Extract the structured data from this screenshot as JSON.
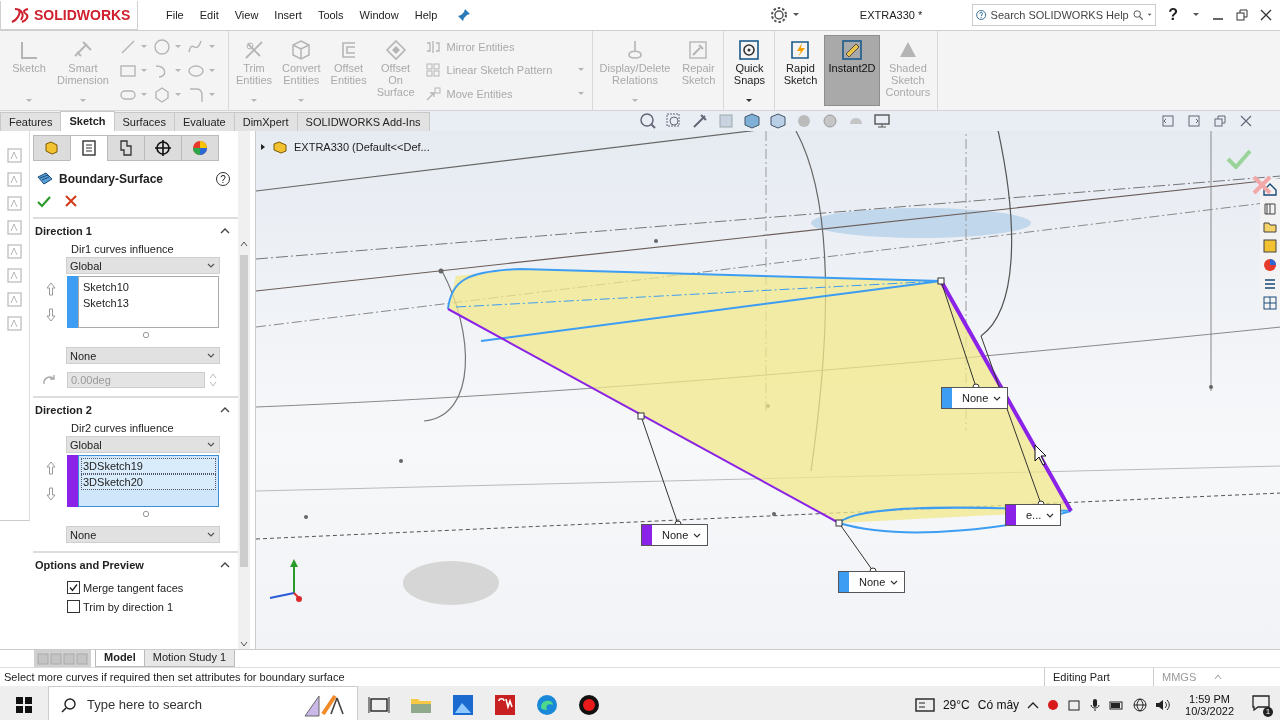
{
  "title_bar": {
    "logo": "SOLIDWORKS",
    "menu": [
      "File",
      "Edit",
      "View",
      "Insert",
      "Tools",
      "Window",
      "Help"
    ],
    "document_title": "EXTRA330 *",
    "search_placeholder": "Search SOLIDWORKS Help",
    "help_label": "?"
  },
  "ribbon": {
    "groups": [
      {
        "commands": [
          {
            "kind": "large",
            "label": "Sketch",
            "disabled": true,
            "dropdown": true
          },
          {
            "kind": "large",
            "label": "Smart Dimension",
            "disabled": true,
            "dropdown": true
          },
          {
            "kind": "tool_grid",
            "disabled": true
          }
        ]
      },
      {
        "commands": [
          {
            "kind": "large",
            "label": "Trim Entities",
            "disabled": true,
            "dropdown": true
          },
          {
            "kind": "large",
            "label": "Convert Entities",
            "disabled": true,
            "dropdown": true
          },
          {
            "kind": "large",
            "label": "Offset Entities",
            "disabled": true,
            "dropdown": false
          },
          {
            "kind": "large",
            "label": "Offset On Surface",
            "disabled": true,
            "dropdown": false
          },
          {
            "kind": "small",
            "label": "Mirror Entities",
            "disabled": true,
            "dropdown": false
          },
          {
            "kind": "small",
            "label": "Linear Sketch Pattern",
            "disabled": true,
            "dropdown": true
          },
          {
            "kind": "small",
            "label": "Move Entities",
            "disabled": true,
            "dropdown": true
          }
        ]
      },
      {
        "commands": [
          {
            "kind": "large",
            "label": "Display/Delete Relations",
            "disabled": true,
            "dropdown": true
          },
          {
            "kind": "large",
            "label": "Repair Sketch",
            "disabled": true,
            "dropdown": false
          }
        ]
      },
      {
        "commands": [
          {
            "kind": "large",
            "label": "Quick Snaps",
            "disabled": false,
            "dropdown": true
          }
        ]
      },
      {
        "commands": [
          {
            "kind": "large",
            "label": "Rapid Sketch",
            "disabled": false,
            "dropdown": false,
            "selected": false
          },
          {
            "kind": "large",
            "label": "Instant2D",
            "disabled": false,
            "dropdown": false,
            "selected": true
          },
          {
            "kind": "large",
            "label": "Shaded Sketch Contours",
            "disabled": true,
            "dropdown": false,
            "selected": false
          }
        ]
      }
    ]
  },
  "command_tabs": [
    {
      "label": "Features",
      "selected": false
    },
    {
      "label": "Sketch",
      "selected": true
    },
    {
      "label": "Surfaces",
      "selected": false
    },
    {
      "label": "Evaluate",
      "selected": false
    },
    {
      "label": "DimXpert",
      "selected": false
    },
    {
      "label": "SOLIDWORKS Add-Ins",
      "selected": false
    }
  ],
  "property_manager": {
    "tabs": [
      {
        "selected": false
      },
      {
        "selected": true
      },
      {
        "selected": false
      },
      {
        "selected": false
      },
      {
        "selected": false
      }
    ],
    "title": "Boundary-Surface",
    "help_label": "?",
    "sections": [
      {
        "kind": "direction",
        "title": "Direction 1",
        "expanded": true,
        "influence_label": "Dir1 curves influence",
        "influence": "Global",
        "color": "#3d9df3",
        "curves": [
          {
            "name": "Sketch10",
            "selected": false
          },
          {
            "name": "Sketch13",
            "selected": false
          }
        ],
        "tangency": "None",
        "angle": {
          "value": "0.00deg",
          "disabled": true
        }
      },
      {
        "kind": "direction",
        "title": "Direction 2",
        "expanded": true,
        "influence_label": "Dir2 curves influence",
        "influence": "Global",
        "color": "#8a22e8",
        "curves": [
          {
            "name": "3DSketch19",
            "selected": true
          },
          {
            "name": "3DSketch20",
            "selected": true
          }
        ],
        "tangency": "None"
      },
      {
        "kind": "options",
        "title": "Options and Preview",
        "expanded": true,
        "options": [
          {
            "label": "Merge tangent faces",
            "checked": true
          },
          {
            "label": "Trim by direction 1",
            "checked": false
          }
        ]
      }
    ]
  },
  "viewport": {
    "breadcrumb": "EXTRA330  (Default<<Def...",
    "callouts": [
      {
        "text": "None",
        "color": "#3d9df3"
      },
      {
        "text": "None",
        "color": "#8a22e8"
      },
      {
        "text": "None",
        "color": "#3d9df3"
      },
      {
        "text": "e...",
        "color": "#8a22e8"
      }
    ]
  },
  "bottom_tabs": [
    {
      "label": "Model",
      "selected": true
    },
    {
      "label": "Motion Study 1",
      "selected": false
    }
  ],
  "status_bar": {
    "message": "Select more curves if required then set attributes for boundary surface",
    "mode": "Editing Part",
    "units": "MMGS"
  },
  "taskbar": {
    "search_placeholder": "Type here to search",
    "temperature": "29°C",
    "weather": "Có mây",
    "time": "1:59 PM",
    "date": "10/3/2022",
    "notifications": "1"
  }
}
